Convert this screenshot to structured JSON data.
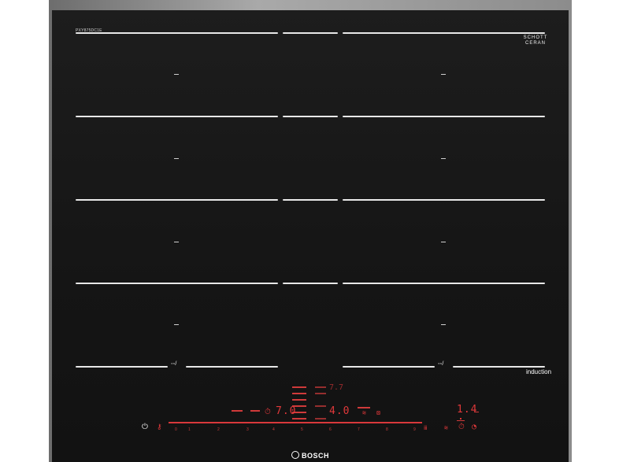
{
  "brand": "BOSCH",
  "glass_label": "SCHOTT CERAN",
  "model_text": "PXY875DC1E",
  "induction_label": "induction",
  "flex_symbol": "◦◦/",
  "displays": {
    "zone_left": "7.0",
    "zone_right": "4.0",
    "timer": "1.4",
    "top_indicator": "7.7"
  },
  "power_levels": [
    "0",
    "1",
    "2",
    "3",
    "4",
    "5",
    "6",
    "7",
    "8",
    "9"
  ],
  "colors": {
    "display_red": "#e0383a",
    "glass": "#161616",
    "frame": "#8c8c8c"
  },
  "icons": {
    "power": "power-icon",
    "child_lock": "childlock-icon",
    "boost": "boost-icon",
    "timer": "timer-icon",
    "clock": "clock-icon",
    "keep_warm": "keepwarm-icon",
    "fry_sensor": "frysensor-icon"
  }
}
